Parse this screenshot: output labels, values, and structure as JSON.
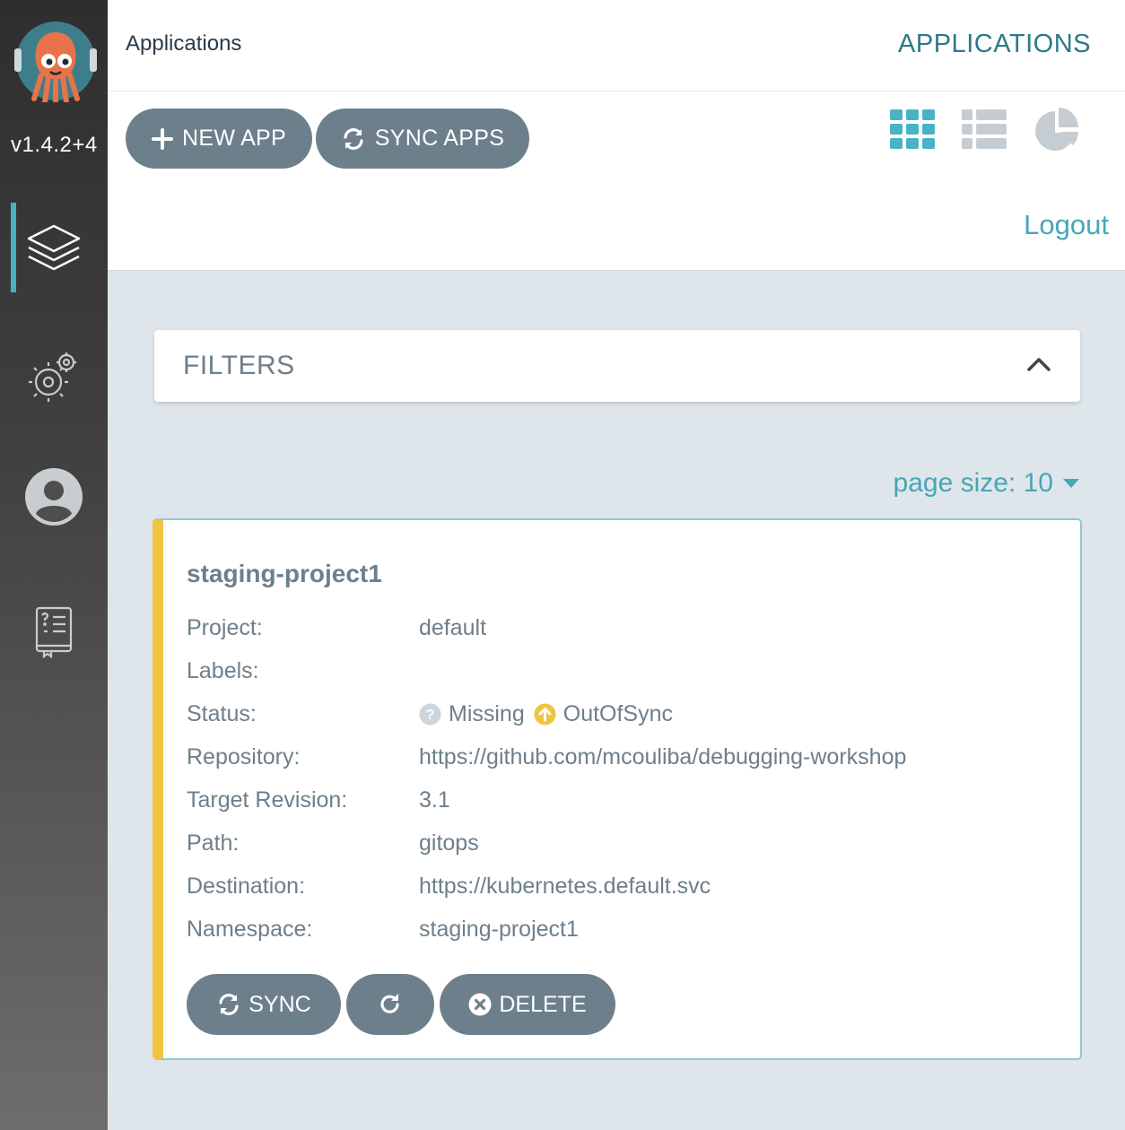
{
  "sidebar": {
    "version": "v1.4.2+4",
    "items": [
      {
        "name": "applications",
        "icon": "layers-icon",
        "active": true
      },
      {
        "name": "settings",
        "icon": "gears-icon",
        "active": false
      },
      {
        "name": "user-info",
        "icon": "user-icon",
        "active": false
      },
      {
        "name": "docs",
        "icon": "docs-book-icon",
        "active": false
      }
    ]
  },
  "header": {
    "breadcrumb": "Applications",
    "title": "APPLICATIONS"
  },
  "toolbar": {
    "new_app_label": "NEW APP",
    "sync_apps_label": "SYNC APPS",
    "views": [
      "tiles-view-icon",
      "list-view-icon",
      "summary-pie-icon"
    ],
    "logout_label": "Logout"
  },
  "filters": {
    "label": "FILTERS"
  },
  "pagination": {
    "page_size_label": "page size: 10"
  },
  "app": {
    "name": "staging-project1",
    "fields": [
      {
        "key": "Project:",
        "value": "default"
      },
      {
        "key": "Labels:",
        "value": ""
      },
      {
        "key": "Status:",
        "health": "Missing",
        "sync": "OutOfSync"
      },
      {
        "key": "Repository:",
        "value": "https://github.com/mcouliba/debugging-workshop"
      },
      {
        "key": "Target Revision:",
        "value": "3.1"
      },
      {
        "key": "Path:",
        "value": "gitops"
      },
      {
        "key": "Destination:",
        "value": "https://kubernetes.default.svc"
      },
      {
        "key": "Namespace:",
        "value": "staging-project1"
      }
    ],
    "actions": {
      "sync_label": "SYNC",
      "delete_label": "DELETE"
    }
  },
  "colors": {
    "accent": "#48a6b5",
    "button": "#6d7f8b",
    "out_of_sync": "#f0c442",
    "missing": "#ccd6dd"
  }
}
